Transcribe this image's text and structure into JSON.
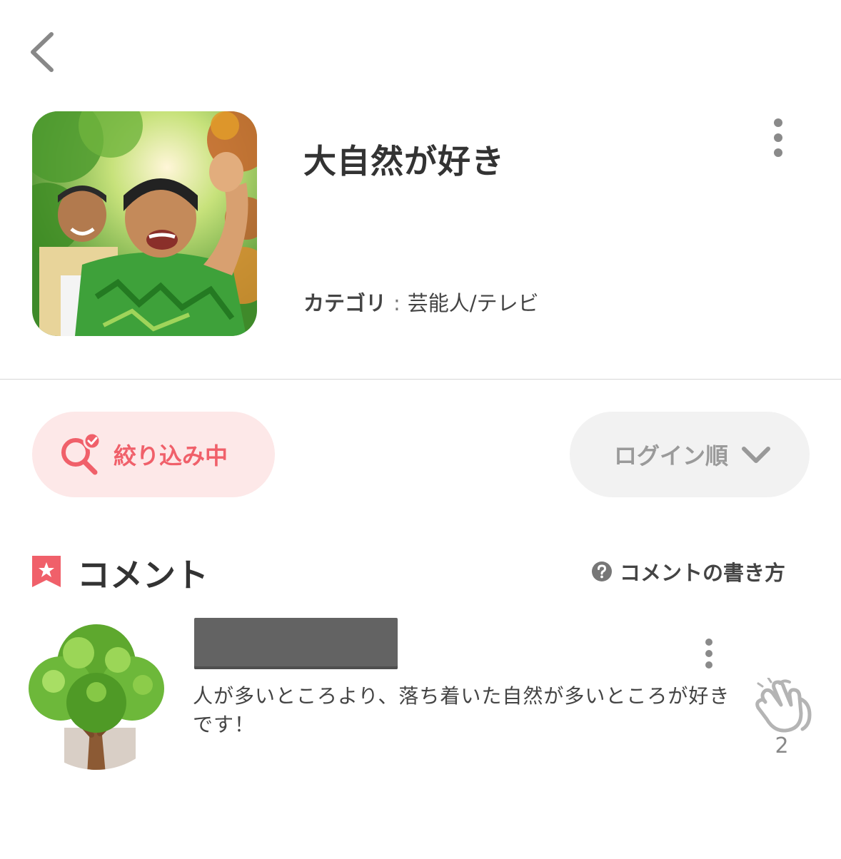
{
  "nav": {
    "back_icon": "chevron-left-icon"
  },
  "community": {
    "title": "大自然が好き",
    "category_label": "カテゴリ",
    "category_separator": ":",
    "category_value": "芸能人/テレビ",
    "more_icon": "vertical-dots-icon"
  },
  "filters": {
    "filter_label": "絞り込み中",
    "filter_icon": "search-check-icon",
    "sort_label": "ログイン順",
    "sort_icon": "chevron-down-icon"
  },
  "comments_section": {
    "title": "コメント",
    "title_icon": "bookmark-star-icon",
    "help_label": "コメントの書き方",
    "help_icon": "question-circle-icon"
  },
  "comments": [
    {
      "text": "人が多いところより、落ち着いた自然が多いところが好きです！",
      "clap_count": "2",
      "avatar": "tree-avatar",
      "username_redacted": true
    }
  ],
  "colors": {
    "accent": "#f0606a",
    "filter_bg": "#fde8e8",
    "sort_bg": "#f2f2f2",
    "text_primary": "#333333",
    "text_muted": "#9a9a9a",
    "redaction": "#636363"
  }
}
